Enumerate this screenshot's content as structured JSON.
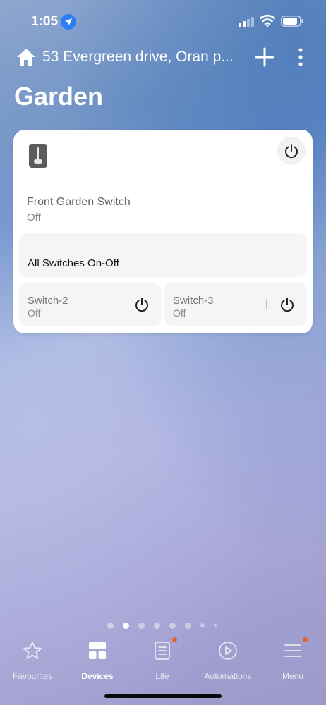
{
  "status_bar": {
    "time": "1:05"
  },
  "header": {
    "address": "53 Evergreen drive, Oran p...",
    "room_title": "Garden"
  },
  "card": {
    "device_name": "Front Garden Switch",
    "device_status": "Off",
    "all_switches_label": "All Switches On-Off",
    "switches": [
      {
        "name": "Switch-2",
        "status": "Off"
      },
      {
        "name": "Switch-3",
        "status": "Off"
      }
    ]
  },
  "tabs": [
    {
      "label": "Favourites",
      "icon": "star-icon"
    },
    {
      "label": "Devices",
      "icon": "grid-icon",
      "active": true
    },
    {
      "label": "Life",
      "icon": "list-icon",
      "badge": true
    },
    {
      "label": "Automations",
      "icon": "play-icon"
    },
    {
      "label": "Menu",
      "icon": "menu-icon",
      "badge": true
    }
  ],
  "colors": {
    "accent_badge": "#e8622b",
    "location": "#2f7cf6"
  }
}
